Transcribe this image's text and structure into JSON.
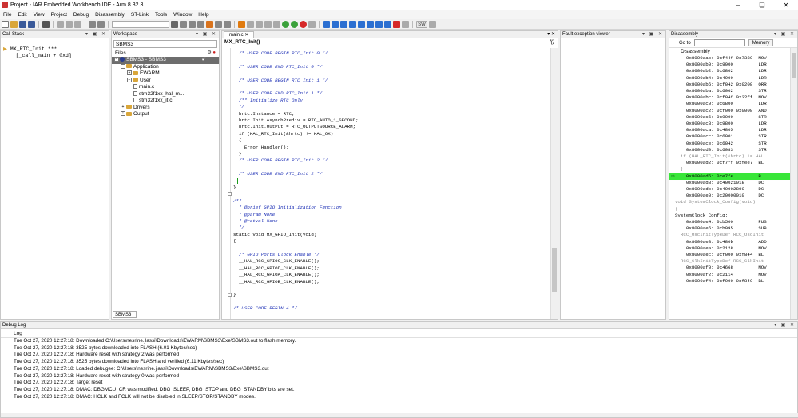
{
  "window": {
    "title": "Project - IAR Embedded Workbench IDE - Arm 8.32.3"
  },
  "menu": [
    "File",
    "Edit",
    "View",
    "Project",
    "Debug",
    "Disassembly",
    "ST-Link",
    "Tools",
    "Window",
    "Help"
  ],
  "toolbar": {
    "sw_label": "SW"
  },
  "call_stack": {
    "title": "Call Stack",
    "rows": [
      "MX_RTC_Init ***",
      "  [_call_main + 0xd]"
    ]
  },
  "workspace": {
    "title": "Workspace",
    "combo_value": "SBMS3",
    "files_label": "Files",
    "tree": [
      {
        "label": "SBMS3 - SBMS3",
        "level": 0,
        "kind": "proj",
        "selected": true
      },
      {
        "label": "Application",
        "level": 1,
        "kind": "folder"
      },
      {
        "label": "EWARM",
        "level": 2,
        "kind": "folder"
      },
      {
        "label": "User",
        "level": 2,
        "kind": "folder"
      },
      {
        "label": "main.c",
        "level": 3,
        "kind": "file"
      },
      {
        "label": "stm32f1xx_hal_m...",
        "level": 3,
        "kind": "file"
      },
      {
        "label": "stm32f1xx_it.c",
        "level": 3,
        "kind": "file"
      },
      {
        "label": "Drivers",
        "level": 1,
        "kind": "folder"
      },
      {
        "label": "Output",
        "level": 1,
        "kind": "folder"
      }
    ],
    "bottom_tab": "SBMS3"
  },
  "editor": {
    "tab": "main.c",
    "function": "MX_RTC_Init()",
    "func_button": "f()",
    "lines": [
      {
        "text": "  /* USER CODE BEGIN RTC_Init 0 */",
        "kind": "com"
      },
      {
        "text": "",
        "kind": "kw"
      },
      {
        "text": "  /* USER CODE END RTC_Init 0 */",
        "kind": "com"
      },
      {
        "text": "",
        "kind": "kw"
      },
      {
        "text": "  /* USER CODE BEGIN RTC_Init 1 */",
        "kind": "com"
      },
      {
        "text": "",
        "kind": "kw"
      },
      {
        "text": "  /* USER CODE END RTC_Init 1 */",
        "kind": "com"
      },
      {
        "text": "  /** Initialize RTC Only",
        "kind": "com"
      },
      {
        "text": "  */",
        "kind": "com"
      },
      {
        "text": "  hrtc.Instance = RTC;",
        "kind": "kw"
      },
      {
        "text": "  hrtc.Init.AsynchPrediv = RTC_AUTO_1_SECOND;",
        "kind": "kw"
      },
      {
        "text": "  hrtc.Init.OutPut = RTC_OUTPUTSOURCE_ALARM;",
        "kind": "kw"
      },
      {
        "text": "  if (HAL_RTC_Init(&hrtc) != HAL_OK)",
        "kind": "kw"
      },
      {
        "text": "  {",
        "kind": "kw"
      },
      {
        "text": "    Error_Handler();",
        "kind": "kw"
      },
      {
        "text": "  }",
        "kind": "kw"
      },
      {
        "text": "  /* USER CODE BEGIN RTC_Init 2 */",
        "kind": "com"
      },
      {
        "text": "",
        "kind": "kw"
      },
      {
        "text": "  /* USER CODE END RTC_Init 2 */",
        "kind": "com"
      },
      {
        "text": "",
        "kind": "kw"
      },
      {
        "text": "}",
        "kind": "kw"
      },
      {
        "text": "",
        "kind": "kw"
      },
      {
        "text": "/**",
        "kind": "com"
      },
      {
        "text": "  * @brief GPIO Initialization Function",
        "kind": "com"
      },
      {
        "text": "  * @param None",
        "kind": "com"
      },
      {
        "text": "  * @retval None",
        "kind": "com"
      },
      {
        "text": "  */",
        "kind": "com"
      },
      {
        "text": "static void MX_GPIO_Init(void)",
        "kind": "kw"
      },
      {
        "text": "{",
        "kind": "kw"
      },
      {
        "text": "",
        "kind": "kw"
      },
      {
        "text": "  /* GPIO Ports Clock Enable */",
        "kind": "com"
      },
      {
        "text": "  __HAL_RCC_GPIOC_CLK_ENABLE();",
        "kind": "kw"
      },
      {
        "text": "  __HAL_RCC_GPIOD_CLK_ENABLE();",
        "kind": "kw"
      },
      {
        "text": "  __HAL_RCC_GPIOA_CLK_ENABLE();",
        "kind": "kw"
      },
      {
        "text": "  __HAL_RCC_GPIOB_CLK_ENABLE();",
        "kind": "kw"
      },
      {
        "text": "",
        "kind": "kw"
      },
      {
        "text": "}",
        "kind": "kw"
      },
      {
        "text": "",
        "kind": "kw"
      },
      {
        "text": "/* USER CODE BEGIN 4 */",
        "kind": "com"
      }
    ]
  },
  "fault_viewer": {
    "title": "Fault exception viewer"
  },
  "disassembly": {
    "title": "Disassembly",
    "goto_label": "Go to",
    "memory_button": "Memory",
    "header": "Disassembly",
    "lines": [
      {
        "text": "      0x8000aac: 0xf44f 0x7380  MOV",
        "kind": "code"
      },
      {
        "text": "      0x8000ab0: 0x9900         LDR",
        "kind": "code"
      },
      {
        "text": "      0x8000ab2: 0x6802         LDR",
        "kind": "code"
      },
      {
        "text": "      0x8000ab4: 0x4909         LDR",
        "kind": "code"
      },
      {
        "text": "      0x8000ab6: 0xf042 0x0208  ORR",
        "kind": "code"
      },
      {
        "text": "      0x8000aba: 0x6002         STR",
        "kind": "code"
      },
      {
        "text": "      0x8000abc: 0xf04f 0x32ff  MOV",
        "kind": "code"
      },
      {
        "text": "      0x8000ac0: 0x6800         LDR",
        "kind": "code"
      },
      {
        "text": "      0x8000ac2: 0xf000 0x0008  AND",
        "kind": "code"
      },
      {
        "text": "      0x8000ac6: 0x9000         STR",
        "kind": "code"
      },
      {
        "text": "      0x8000ac8: 0x9800         LDR",
        "kind": "code"
      },
      {
        "text": "      0x8000aca: 0x4805         LDR",
        "kind": "code"
      },
      {
        "text": "      0x8000acc: 0x6001         STR",
        "kind": "code"
      },
      {
        "text": "      0x8000ace: 0x6042         STR",
        "kind": "code"
      },
      {
        "text": "      0x8000ad0: 0x6083         STR",
        "kind": "code"
      },
      {
        "text": "    if (HAL_RTC_Init(&hrtc) != HAL",
        "kind": "src"
      },
      {
        "text": "      0x8000ad2: 0xf7ff 0xfee7  BL",
        "kind": "code"
      },
      {
        "text": "    }",
        "kind": "src"
      },
      {
        "text": "      0x8000ad6: 0xe7fe         B",
        "kind": "hl"
      },
      {
        "text": "      0x8000ad8: 0x40021018     DC",
        "kind": "code"
      },
      {
        "text": "      0x8000adc: 0x40002800     DC",
        "kind": "code"
      },
      {
        "text": "      0x8000ae0: 0x20000010     DC",
        "kind": "code"
      },
      {
        "text": "  void SystemClock_Config(void)",
        "kind": "src"
      },
      {
        "text": "  {",
        "kind": "src"
      },
      {
        "text": "  SystemClock_Config:",
        "kind": "lbl"
      },
      {
        "text": "      0x8000ae4: 0xb500         PUS",
        "kind": "code"
      },
      {
        "text": "      0x8000ae6: 0xb095         SUB",
        "kind": "code"
      },
      {
        "text": "    RCC_OscInitTypeDef RCC_OscInit",
        "kind": "src"
      },
      {
        "text": "      0x8000ae8: 0x480b         ADD",
        "kind": "code"
      },
      {
        "text": "      0x8000aea: 0x2128         MOV",
        "kind": "code"
      },
      {
        "text": "      0x8000aec: 0xf000 0xf844  BL",
        "kind": "code"
      },
      {
        "text": "    RCC_ClkInitTypeDef RCC_ClkInit",
        "kind": "src"
      },
      {
        "text": "      0x8000af0: 0x4668         MOV",
        "kind": "code"
      },
      {
        "text": "      0x8000af2: 0x2114         MOV",
        "kind": "code"
      },
      {
        "text": "      0x8000af4: 0xf000 0xf840  BL",
        "kind": "code"
      }
    ]
  },
  "debug_log": {
    "title": "Debug Log",
    "header": "Log",
    "lines": [
      "Tue Oct 27, 2020 12:27:18: Downloaded C:\\Users\\nesrine.jlassi\\Downloads\\EWARM\\SBMS3\\Exe\\SBMS3.out to flash memory.",
      "Tue Oct 27, 2020 12:27:18: 3525 bytes downloaded into FLASH (6.01 Kbytes/sec)",
      "Tue Oct 27, 2020 12:27:18: Hardware reset with strategy 2 was performed",
      "Tue Oct 27, 2020 12:27:18: 3525 bytes downloaded into FLASH and verified (6.11 Kbytes/sec)",
      "Tue Oct 27, 2020 12:27:18: Loaded debugee: C:\\Users\\nesrine.jlassi\\Downloads\\EWARM\\SBMS3\\Exe\\SBMS3.out",
      "Tue Oct 27, 2020 12:27:18: Hardware reset with strategy 0 was performed",
      "Tue Oct 27, 2020 12:27:18: Target reset",
      "Tue Oct 27, 2020 12:27:18: DMAC: DBGMCU_CR was modified. DBG_SLEEP, DBG_STOP and DBG_STANDBY bits are set.",
      "Tue Oct 27, 2020 12:27:18: DMAC: HCLK and FCLK will not be disabled in SLEEP/STOP/STANDBY modes."
    ]
  },
  "colors": {
    "highlight": "#39e639",
    "comment": "#1c2fb5",
    "selection": "#6d6d6d"
  }
}
